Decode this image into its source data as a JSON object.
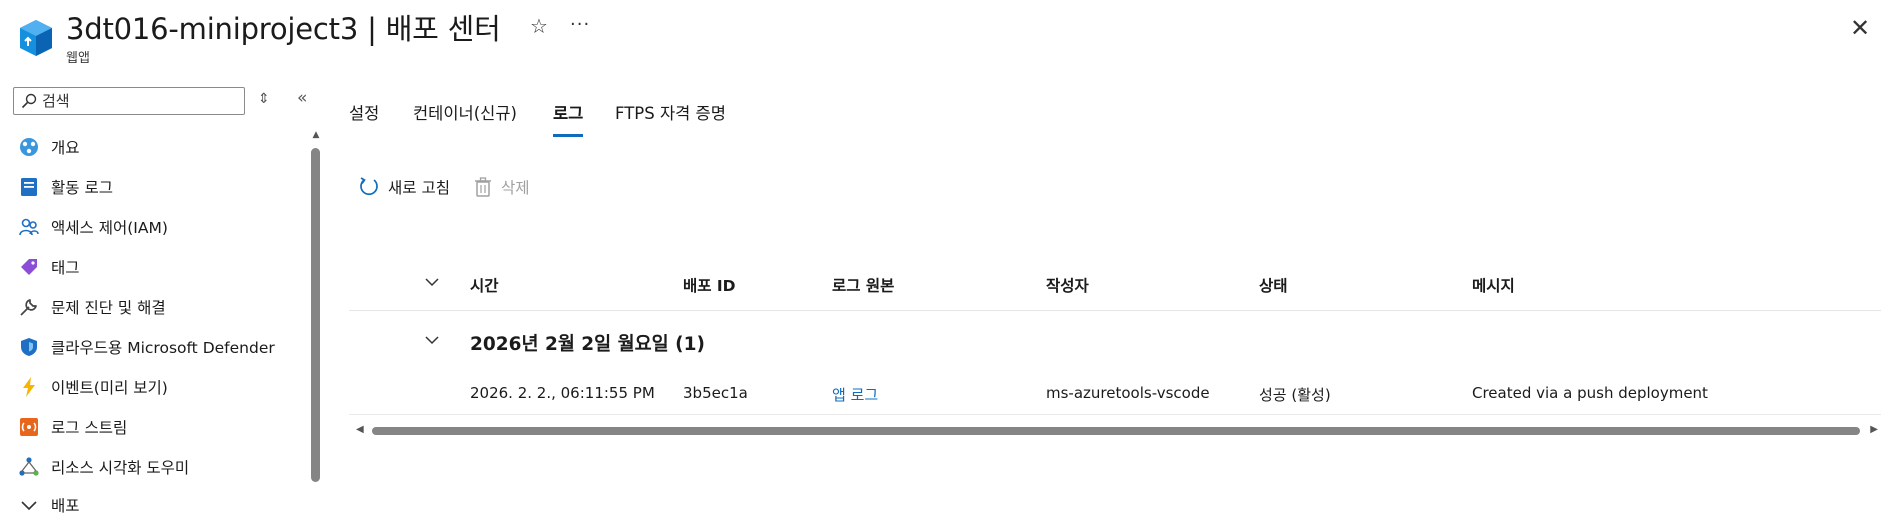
{
  "header": {
    "title": "3dt016-miniproject3 | 배포 센터",
    "subtitle": "웹앱",
    "star_icon": "☆",
    "more_icon": "···",
    "close_icon": "✕"
  },
  "sidebar": {
    "search_placeholder": "검색",
    "sort_icon": "⇕",
    "collapse_icon": "«",
    "items": [
      {
        "label": "개요",
        "icon": "overview-icon"
      },
      {
        "label": "활동 로그",
        "icon": "activity-log-icon"
      },
      {
        "label": "액세스 제어(IAM)",
        "icon": "iam-icon"
      },
      {
        "label": "태그",
        "icon": "tag-icon"
      },
      {
        "label": "문제 진단 및 해결",
        "icon": "wrench-icon"
      },
      {
        "label": "클라우드용 Microsoft Defender",
        "icon": "defender-shield-icon"
      },
      {
        "label": "이벤트(미리 보기)",
        "icon": "lightning-icon"
      },
      {
        "label": "로그 스트림",
        "icon": "log-stream-icon"
      },
      {
        "label": "리소스 시각화 도우미",
        "icon": "resource-visualizer-icon"
      },
      {
        "label": "배포",
        "icon": "chevron-down-icon"
      }
    ]
  },
  "tabs": [
    {
      "label": "설정"
    },
    {
      "label": "컨테이너(신규)"
    },
    {
      "label": "로그"
    },
    {
      "label": "FTPS 자격 증명"
    }
  ],
  "active_tab_index": 2,
  "toolbar": {
    "refresh_label": "새로 고침",
    "delete_label": "삭제"
  },
  "grid": {
    "columns": [
      "시간",
      "배포 ID",
      "로그 원본",
      "작성자",
      "상태",
      "메시지"
    ],
    "groups": [
      {
        "label": "2026년 2월 2일 월요일 (1)",
        "rows": [
          {
            "time": "2026. 2. 2., 06:11:55 PM",
            "deployment_id": "3b5ec1a",
            "log_source": "앱 로그",
            "author": "ms-azuretools-vscode",
            "status": "성공 (활성)",
            "message": "Created via a push deployment"
          }
        ]
      }
    ]
  },
  "colors": {
    "accent": "#0f6cbd",
    "disabled": "#a0a0a0"
  }
}
